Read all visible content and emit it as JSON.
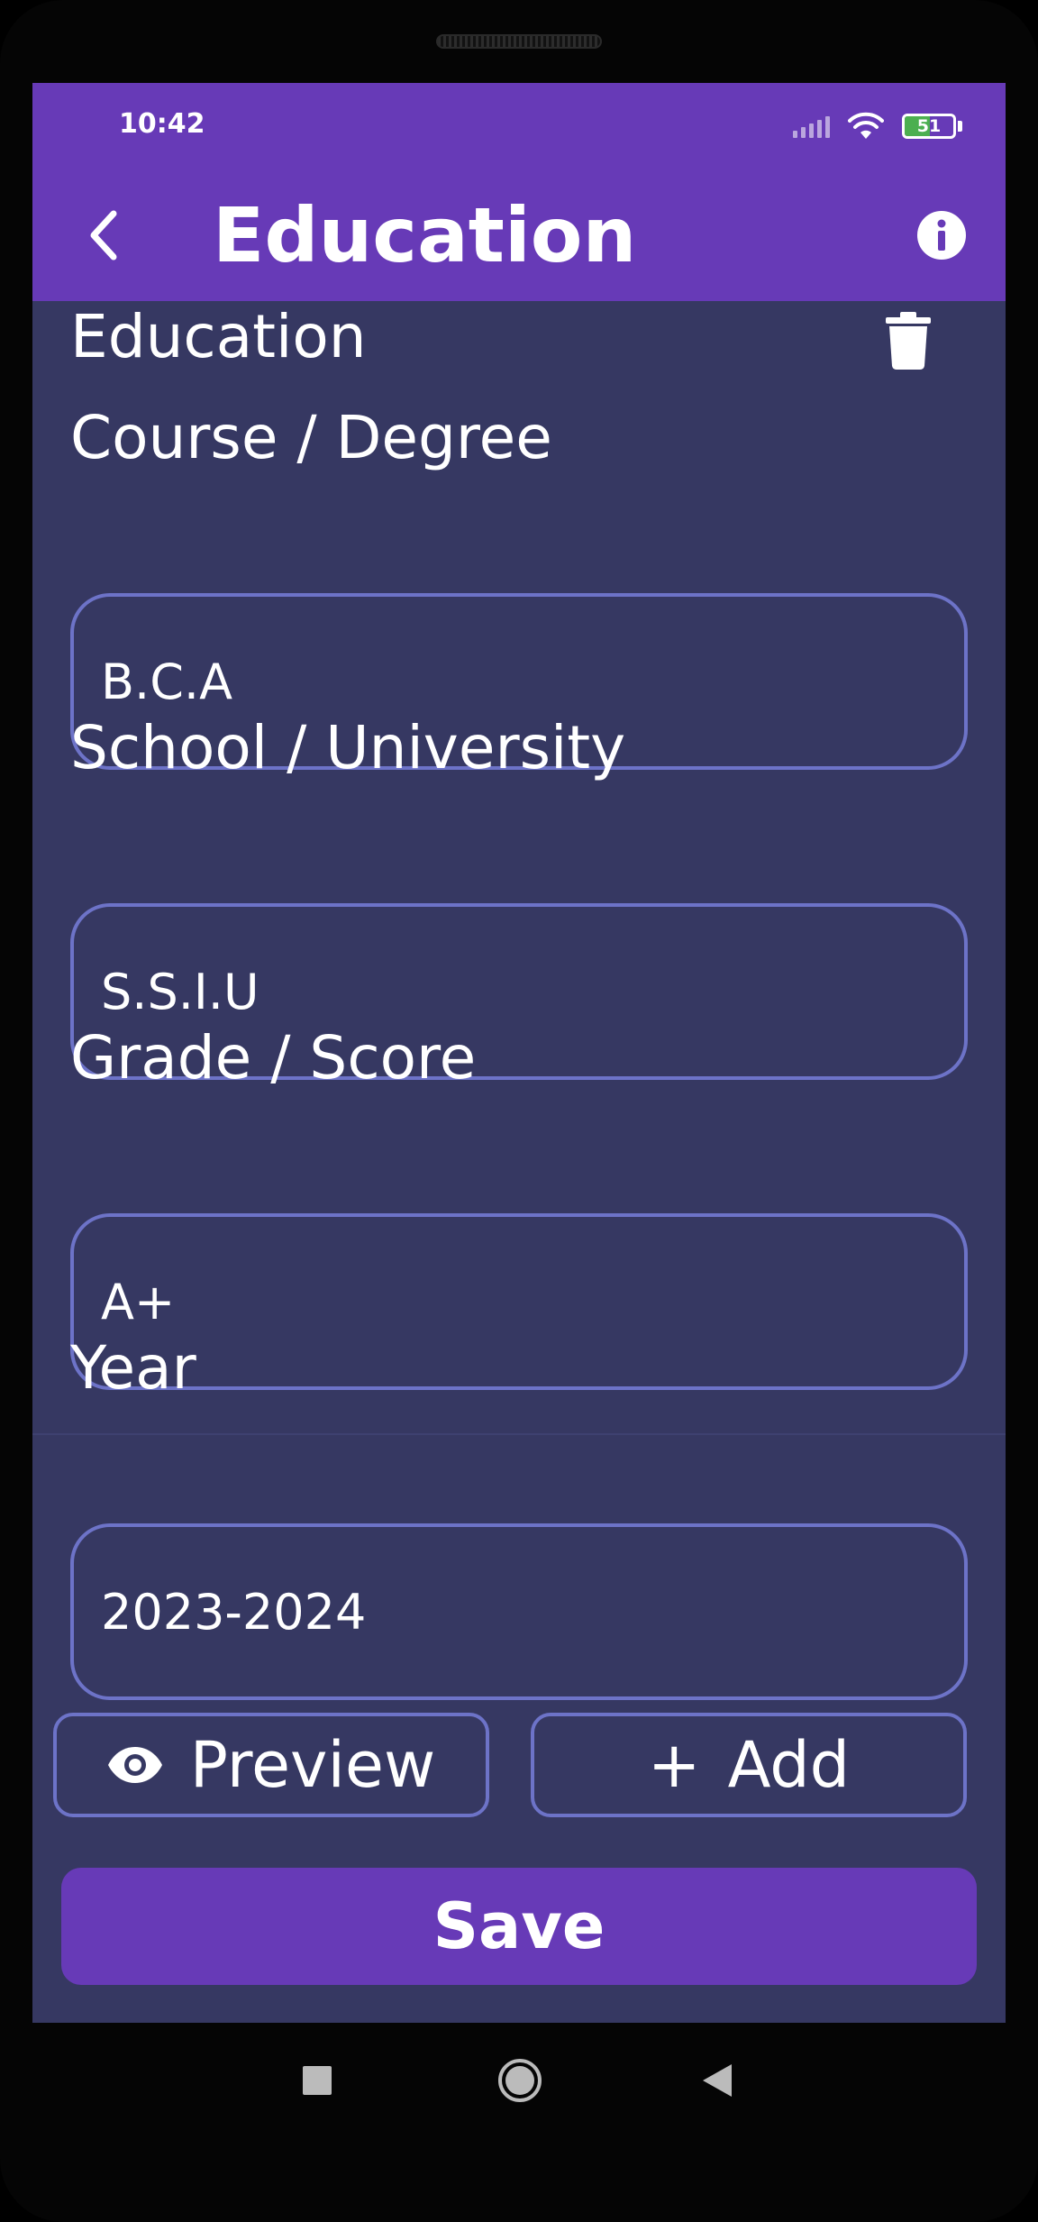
{
  "status_bar": {
    "time": "10:42",
    "battery_level": "51",
    "battery_fill_percent": 51,
    "icons": [
      "signal-icon",
      "wifi-icon",
      "battery-icon"
    ]
  },
  "app_bar": {
    "title": "Education",
    "back_icon": "chevron-left-icon",
    "info_icon": "info-icon"
  },
  "section": {
    "title": "Education",
    "delete_icon": "trash-icon"
  },
  "fields": [
    {
      "label": "Course / Degree",
      "value": "B.C.A"
    },
    {
      "label": "School / University",
      "value": "S.S.I.U"
    },
    {
      "label": "Grade / Score",
      "value": "A+"
    },
    {
      "label": "Year",
      "value": "2023-2024"
    }
  ],
  "actions": {
    "preview_label": "Preview",
    "preview_icon": "eye-icon",
    "add_label": "Add",
    "add_icon": "plus-icon",
    "save_label": "Save"
  },
  "colors": {
    "primary": "#673AB7",
    "background": "#363862",
    "field_border": "#6d73c8"
  }
}
